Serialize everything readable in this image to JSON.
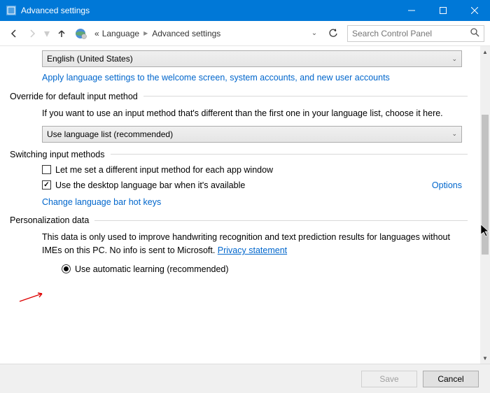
{
  "window": {
    "title": "Advanced settings"
  },
  "nav": {
    "breadcrumb": {
      "prefix": "«",
      "parent": "Language",
      "current": "Advanced settings"
    },
    "search_placeholder": "Search Control Panel"
  },
  "lang_dropdown": {
    "value": "English (United States)"
  },
  "apply_link": "Apply language settings to the welcome screen, system accounts, and new user accounts",
  "override": {
    "title": "Override for default input method",
    "desc": "If you want to use an input method that's different than the first one in your language list, choose it here.",
    "dropdown": "Use language list (recommended)"
  },
  "switching": {
    "title": "Switching input methods",
    "chk1": "Let me set a different input method for each app window",
    "chk2": "Use the desktop language bar when it's available",
    "options": "Options",
    "hotkeys_link": "Change language bar hot keys"
  },
  "personalization": {
    "title": "Personalization data",
    "desc_pre": "This data is only used to improve handwriting recognition and text prediction results for languages without IMEs on this PC. No info is sent to Microsoft. ",
    "privacy_link": "Privacy statement",
    "radio1": "Use automatic learning (recommended)"
  },
  "buttons": {
    "save": "Save",
    "cancel": "Cancel"
  }
}
